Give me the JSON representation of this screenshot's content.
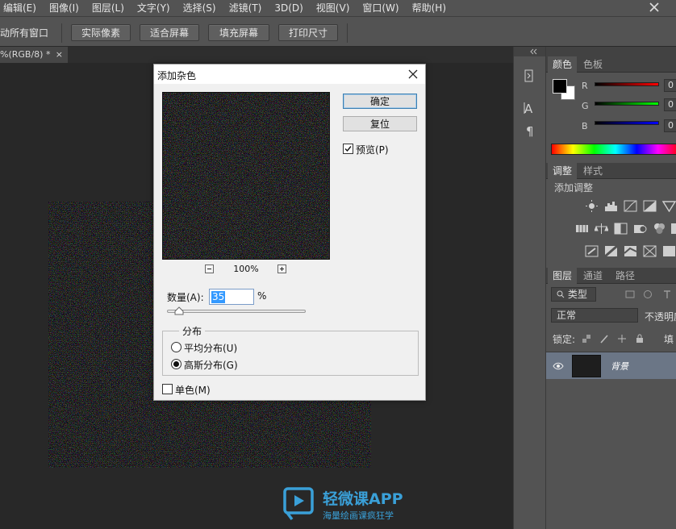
{
  "menu": [
    "编辑(E)",
    "图像(I)",
    "图层(L)",
    "文字(Y)",
    "选择(S)",
    "滤镜(T)",
    "3D(D)",
    "视图(V)",
    "窗口(W)",
    "帮助(H)"
  ],
  "options": {
    "label": "动所有窗口",
    "buttons": [
      "实际像素",
      "适合屏幕",
      "填充屏幕",
      "打印尺寸"
    ]
  },
  "document": {
    "tab_label": "%(RGB/8) *",
    "tab_close": "×"
  },
  "dialog": {
    "title": "添加杂色",
    "ok": "确定",
    "reset": "复位",
    "preview_label": "预览(P)",
    "preview_checked": true,
    "zoom": "100%",
    "amount_label": "数量(A):",
    "amount_value": "35",
    "amount_unit": "%",
    "amount_slider_fraction": 0.09,
    "distribution_label": "分布",
    "uniform_label": "平均分布(U)",
    "gaussian_label": "高斯分布(G)",
    "selected_distribution": "gaussian",
    "mono_label": "单色(M)",
    "mono_checked": false
  },
  "color_panel": {
    "tabs": [
      "颜色",
      "色板"
    ],
    "channels": [
      {
        "label": "R",
        "value": "0"
      },
      {
        "label": "G",
        "value": "0"
      },
      {
        "label": "B",
        "value": "0"
      }
    ],
    "foreground": "#000000",
    "background": "#ffffff"
  },
  "adjust_panel": {
    "tabs": [
      "调整",
      "样式"
    ],
    "add_label": "添加调整"
  },
  "layers_panel": {
    "tabs": [
      "图层",
      "通道",
      "路径"
    ],
    "filter_label": "类型",
    "blend_mode": "正常",
    "opacity_label": "不透明度",
    "lock_label": "锁定:",
    "fill_label": "填",
    "layer_name": "背景"
  },
  "watermark": {
    "title": "轻微课APP",
    "subtitle": "海量绘画课疯狂学"
  }
}
